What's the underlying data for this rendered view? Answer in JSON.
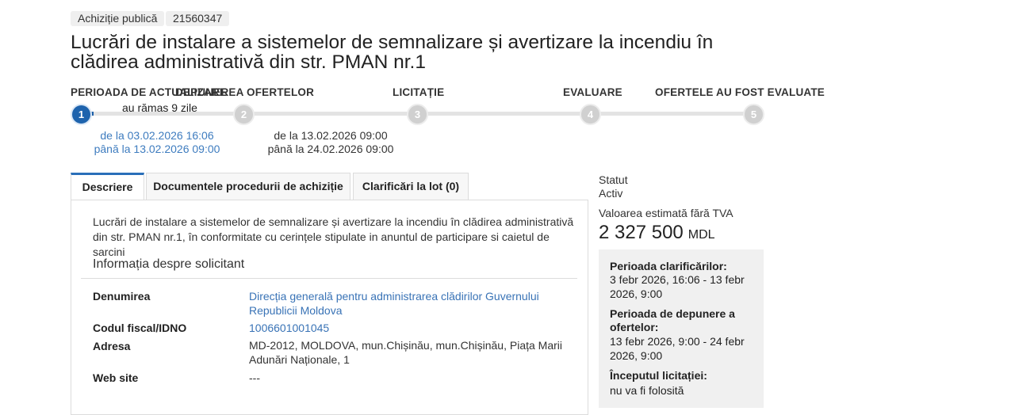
{
  "tags": {
    "type": "Achiziție publică",
    "id": "21560347"
  },
  "title": "Lucrări de instalare a sistemelor de semnalizare și avertizare la incendiu în clădirea administrativă din str. PMAN nr.1",
  "timeline": {
    "stages": [
      {
        "number": "1",
        "label": "PERIOADA DE ACTUALIZARE",
        "active": true
      },
      {
        "number": "2",
        "label": "DEPUNEREA OFERTELOR",
        "active": false
      },
      {
        "number": "3",
        "label": "LICITAȚIE",
        "active": false
      },
      {
        "number": "4",
        "label": "EVALUARE",
        "active": false
      },
      {
        "number": "5",
        "label": "OFERTELE AU FOST EVALUATE",
        "active": false
      }
    ],
    "remaining": "au rămas 9 zile",
    "periods": [
      {
        "from": "de la 03.02.2026 16:06",
        "to": "până la 13.02.2026 09:00"
      },
      {
        "from": "de la 13.02.2026 09:00",
        "to": "până la 24.02.2026 09:00"
      }
    ]
  },
  "tabs": [
    {
      "label": "Descriere",
      "active": true
    },
    {
      "label": "Documentele procedurii de achiziție",
      "active": false
    },
    {
      "label": "Clarificări la lot (0)",
      "active": false
    }
  ],
  "description": "Lucrări de instalare a sistemelor de semnalizare și avertizare la incendiu în clădirea administrativă din str. PMAN nr.1, în conformitate cu cerințele stipulate in anuntul de participare si caietul de sarcini",
  "requester": {
    "section_title": "Informația despre solicitant",
    "rows": [
      {
        "label": "Denumirea",
        "value": "Direcția generală pentru administrarea clădirilor Guvernului Republicii Moldova"
      },
      {
        "label": "Codul fiscal/IDNO",
        "value": "1006601001045"
      },
      {
        "label": "Adresa",
        "value": "MD-2012, MOLDOVA, mun.Chișinău, mun.Chișinău, Piața Marii Adunări Naționale, 1"
      },
      {
        "label": "Web site",
        "value": "---"
      }
    ]
  },
  "sidebar": {
    "status_label": "Statut",
    "status_value": "Activ",
    "value_label": "Valoarea estimată fără TVA",
    "amount": "2 327 500",
    "currency": "MDL",
    "info": [
      {
        "heading": "Perioada clarificărilor:",
        "text": "3 febr 2026, 16:06 - 13 febr 2026, 9:00"
      },
      {
        "heading": "Perioada de depunere a ofertelor:",
        "text": "13 febr 2026, 9:00 - 24 febr 2026, 9:00"
      },
      {
        "heading": "Începutul licitației:",
        "text": "nu va fi folosită"
      }
    ]
  },
  "colors": {
    "accent": "#1e63ad",
    "link": "#3973b6",
    "track": "#e3e3e3"
  }
}
